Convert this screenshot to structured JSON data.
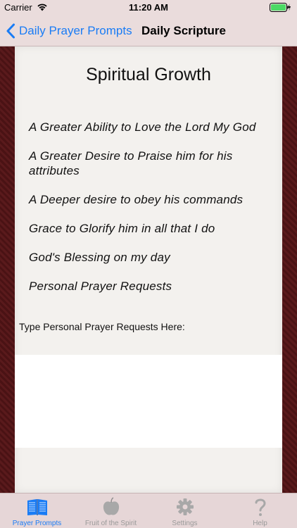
{
  "status_bar": {
    "carrier": "Carrier",
    "time": "11:20 AM",
    "battery_color": "#4cd964"
  },
  "nav": {
    "back_label": "Daily Prayer Prompts",
    "title": "Daily Scripture",
    "accent_color": "#1a7cf5"
  },
  "page": {
    "heading": "Spiritual Growth",
    "prompts": [
      "A Greater Ability to Love the Lord My God",
      "A Greater Desire to Praise him for his attributes",
      "A Deeper desire to obey his commands",
      "Grace to Glorify him in all that I do",
      "God's Blessing on my day",
      "Personal Prayer Requests"
    ],
    "input_label": "Type Personal Prayer Requests Here:",
    "input_value": ""
  },
  "tabs": [
    {
      "label": "Prayer Prompts",
      "icon": "book-icon",
      "active": true
    },
    {
      "label": "Fruit of the Spirit",
      "icon": "fruit-icon",
      "active": false
    },
    {
      "label": "Settings",
      "icon": "gear-icon",
      "active": false
    },
    {
      "label": "Help",
      "icon": "question-icon",
      "active": false
    }
  ]
}
